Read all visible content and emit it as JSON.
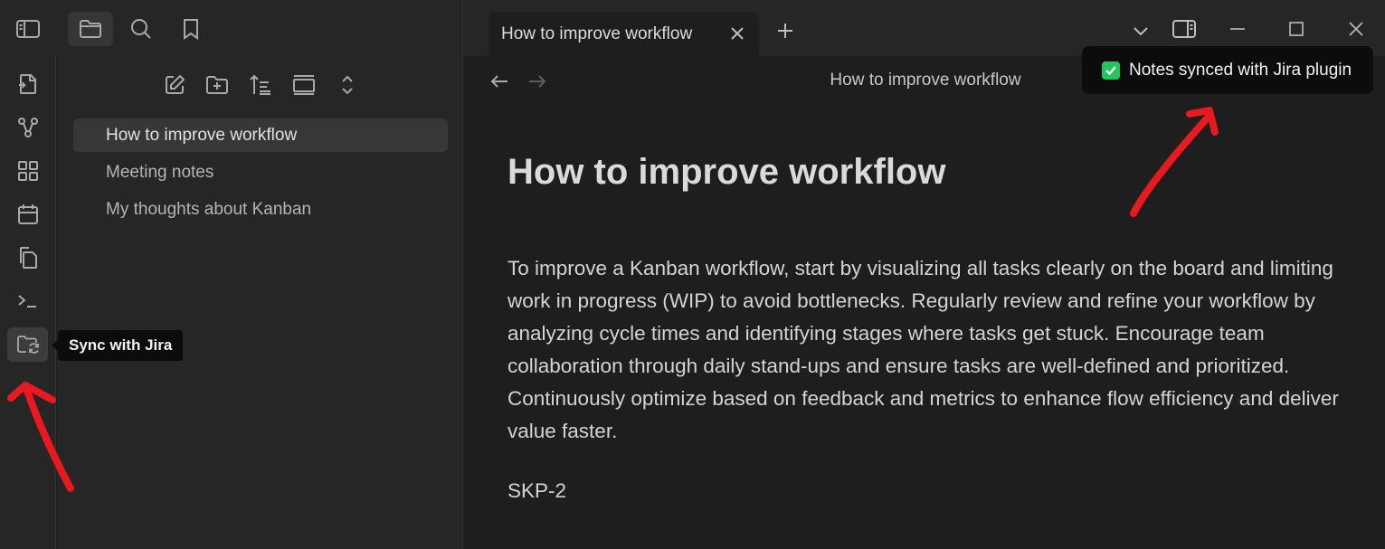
{
  "titlebar": {
    "left_buttons": [
      "sidebar-toggle-icon",
      "folder-icon",
      "search-icon",
      "bookmark-icon"
    ],
    "tab": {
      "title": "How to improve workflow"
    },
    "right_buttons": [
      "chevron-down-icon",
      "sidebar-right-icon",
      "minimize-icon",
      "maximize-icon",
      "close-icon"
    ]
  },
  "ribbon": {
    "items": [
      "file-open-icon",
      "graph-icon",
      "dashboard-icon",
      "calendar-icon",
      "copy-icon",
      "terminal-icon",
      "sync-folder-icon"
    ],
    "tooltip": "Sync with Jira"
  },
  "explorer": {
    "actions": [
      "new-note-icon",
      "new-folder-icon",
      "sort-icon",
      "collapse-icon",
      "expand-icon"
    ],
    "files": [
      {
        "label": "How to improve workflow",
        "active": true
      },
      {
        "label": "Meeting notes",
        "active": false
      },
      {
        "label": "My thoughts about Kanban",
        "active": false
      }
    ]
  },
  "editor": {
    "header_title": "How to improve workflow",
    "note_title": "How to improve workflow",
    "body": "To improve a Kanban workflow, start by visualizing all tasks clearly on the board and limiting work in progress (WIP) to avoid bottlenecks. Regularly review and refine your workflow by analyzing cycle times and identifying stages where tasks get stuck. Encourage team collaboration through daily stand-ups and ensure tasks are well-defined and prioritized. Continuously optimize based on feedback and metrics to enhance flow efficiency and deliver value faster.",
    "tag": "SKP-2"
  },
  "notice": {
    "text": "Notes synced with Jira plugin",
    "check_color": "#22c55e"
  },
  "colors": {
    "background": "#1e1e1e",
    "panel": "#262626",
    "annotation_arrow": "#e8191f"
  }
}
